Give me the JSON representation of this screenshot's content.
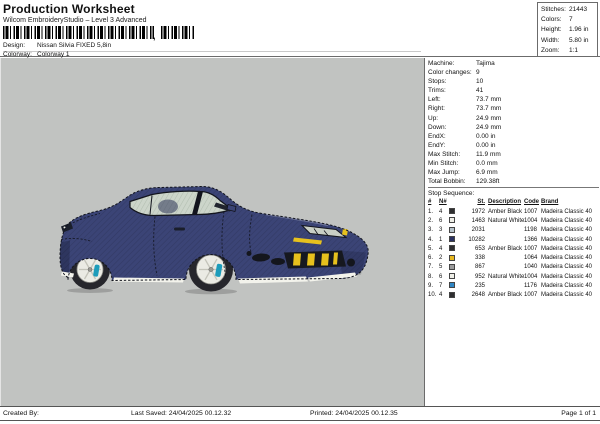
{
  "header": {
    "title": "Production Worksheet",
    "subtitle": "Wilcom EmbroideryStudio – Level 3 Advanced",
    "design_label": "Design:",
    "design_value": "Nissan Silvia FIXED 5,8in",
    "colorway_label": "Colorway:",
    "colorway_value": "Colorway 1"
  },
  "summary": {
    "rows": [
      {
        "label": "Stitches:",
        "value": "21443"
      },
      {
        "label": "Colors:",
        "value": "7"
      },
      {
        "label": "Height:",
        "value": "1.96 in"
      },
      {
        "label": "Width:",
        "value": "5.80 in"
      },
      {
        "label": "Zoom:",
        "value": "1:1"
      }
    ]
  },
  "machine": {
    "rows": [
      {
        "label": "Machine:",
        "value": "Tajima"
      },
      {
        "label": "Color changes:",
        "value": "9"
      },
      {
        "label": "Stops:",
        "value": "10"
      },
      {
        "label": "Trims:",
        "value": "41"
      },
      {
        "label": "Left:",
        "value": "73.7 mm"
      },
      {
        "label": "Right:",
        "value": "73.7 mm"
      },
      {
        "label": "Up:",
        "value": "24.9 mm"
      },
      {
        "label": "Down:",
        "value": "24.9 mm"
      },
      {
        "label": "EndX:",
        "value": "0.00 in"
      },
      {
        "label": "EndY:",
        "value": "0.00 in"
      },
      {
        "label": "Max Stitch:",
        "value": "11.9 mm"
      },
      {
        "label": "Min Stitch:",
        "value": "0.0 mm"
      },
      {
        "label": "Max Jump:",
        "value": "6.9 mm"
      },
      {
        "label": "Total Bobbin:",
        "value": "129.38ft"
      }
    ]
  },
  "stop_sequence": {
    "title": "Stop Sequence:",
    "headers": [
      "#",
      "N#",
      "St.",
      "Description",
      "Code",
      "Brand"
    ],
    "rows": [
      {
        "idx": "1.",
        "n": "4",
        "color": "#2e2e30",
        "st": "1972",
        "desc": "Amber Black",
        "code": "1007",
        "brand": "Madeira Classic 40"
      },
      {
        "idx": "2.",
        "n": "6",
        "color": "#efefe8",
        "st": "1463",
        "desc": "Natural White",
        "code": "1004",
        "brand": "Madeira Classic 40"
      },
      {
        "idx": "3.",
        "n": "3",
        "color": "#b7c3cb",
        "st": "2031",
        "desc": "",
        "code": "1198",
        "brand": "Madeira Classic 40"
      },
      {
        "idx": "4.",
        "n": "1",
        "color": "#2a3161",
        "st": "10282",
        "desc": "",
        "code": "1366",
        "brand": "Madeira Classic 40"
      },
      {
        "idx": "5.",
        "n": "4",
        "color": "#2e2e30",
        "st": "653",
        "desc": "Amber Black",
        "code": "1007",
        "brand": "Madeira Classic 40"
      },
      {
        "idx": "6.",
        "n": "2",
        "color": "#e8b81e",
        "st": "338",
        "desc": "",
        "code": "1064",
        "brand": "Madeira Classic 40"
      },
      {
        "idx": "7.",
        "n": "5",
        "color": "#9b9b9b",
        "st": "867",
        "desc": "",
        "code": "1040",
        "brand": "Madeira Classic 40"
      },
      {
        "idx": "8.",
        "n": "6",
        "color": "#efefe8",
        "st": "952",
        "desc": "Natural White",
        "code": "1004",
        "brand": "Madeira Classic 40"
      },
      {
        "idx": "9.",
        "n": "7",
        "color": "#2f86c4",
        "st": "235",
        "desc": "",
        "code": "1176",
        "brand": "Madeira Classic 40"
      },
      {
        "idx": "10.",
        "n": "4",
        "color": "#2e2e30",
        "st": "2648",
        "desc": "Amber Black",
        "code": "1007",
        "brand": "Madeira Classic 40"
      }
    ]
  },
  "footer": {
    "created_by": "Created By:",
    "last_saved": "Last Saved: 24/04/2025 00.12.32",
    "printed": "Printed: 24/04/2025 00.12.35",
    "page": "Page 1 of 1"
  },
  "design_preview": {
    "description": "Navy blue Nissan Silvia S15 side-view embroidery design",
    "colors": {
      "canvas": "#c1c3c1",
      "body": "#3b4476",
      "trim": "#12141d",
      "glass": "#ccd5ca",
      "rim": "#ebebe4",
      "tire": "#26262c",
      "caliper": "#1d9cba",
      "yellow": "#e7c11d",
      "white": "#f3f3ec"
    }
  }
}
